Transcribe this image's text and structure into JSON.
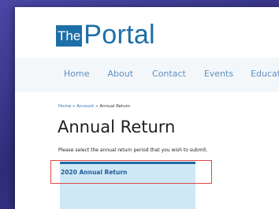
{
  "logo": {
    "box_text": "The",
    "word_text": "Portal"
  },
  "nav": {
    "items": [
      "Home",
      "About",
      "Contact",
      "Events",
      "Educati"
    ]
  },
  "breadcrumb": {
    "home": "Home",
    "sep1": " » ",
    "account": "Account",
    "sep2": " » ",
    "current": "Annual Return"
  },
  "page": {
    "title": "Annual Return",
    "instructions": "Please select the annual return period that you wish to submit."
  },
  "returns": {
    "option_label": "2020 Annual Return"
  },
  "colors": {
    "brand": "#1d6fa8",
    "nav_link": "#5e8fbf",
    "card_bg": "#cfe8f6",
    "highlight": "#e04848"
  }
}
